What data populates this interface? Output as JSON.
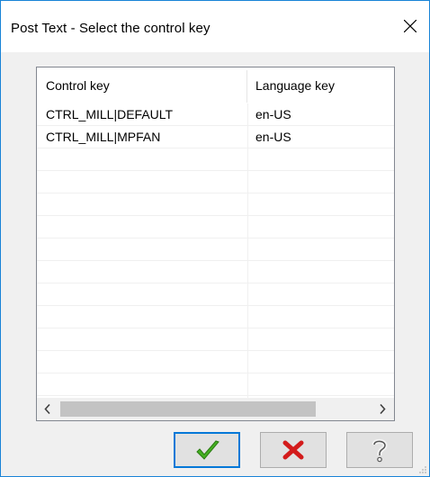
{
  "window": {
    "title": "Post Text - Select the control key"
  },
  "table": {
    "columns": [
      "Control key",
      "Language key"
    ],
    "rows": [
      {
        "control_key": "CTRL_MILL|DEFAULT",
        "language_key": "en-US"
      },
      {
        "control_key": "CTRL_MILL|MPFAN",
        "language_key": "en-US"
      }
    ],
    "empty_rows": 11
  },
  "icons": {
    "close": "close-icon",
    "scroll_left": "chevron-left-icon",
    "scroll_right": "chevron-right-icon",
    "ok": "checkmark-icon",
    "cancel": "red-x-icon",
    "help": "question-mark-icon"
  },
  "colors": {
    "window_border": "#1883d7",
    "primary_button_border": "#0078d7",
    "ok_check": "#44b022",
    "cancel_x": "#d31b1b"
  }
}
